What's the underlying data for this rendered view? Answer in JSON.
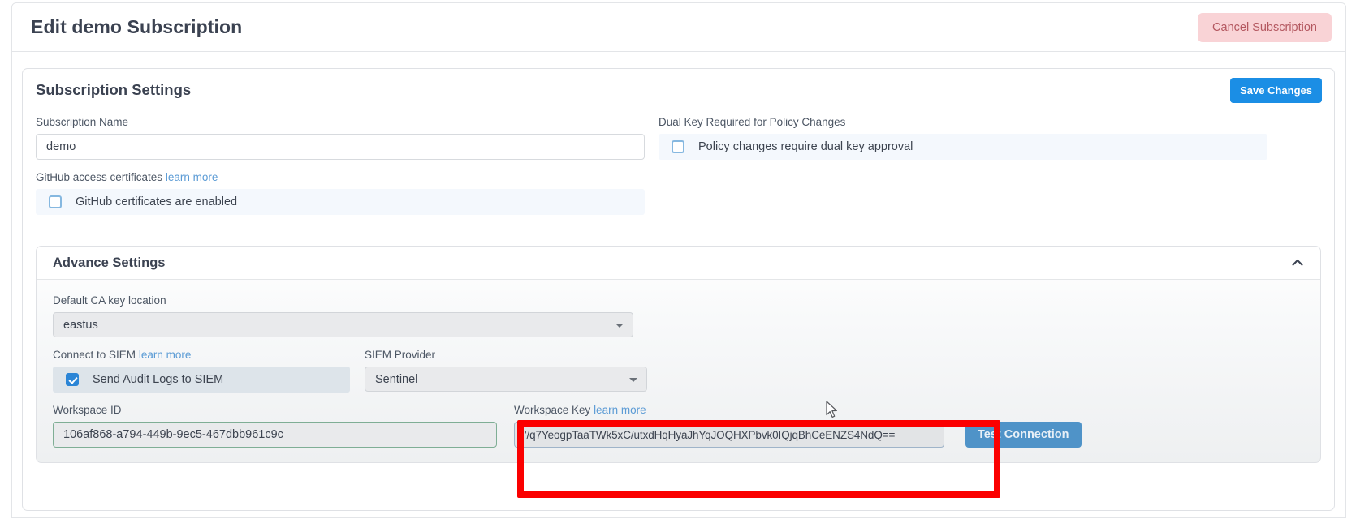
{
  "header": {
    "title": "Edit demo Subscription",
    "cancel_button": "Cancel Subscription"
  },
  "settings_card": {
    "title": "Subscription Settings",
    "save_button": "Save Changes"
  },
  "form": {
    "subscription_name": {
      "label": "Subscription Name",
      "value": "demo"
    },
    "github_certificates": {
      "label": "GitHub access certificates",
      "learn_more": "learn more",
      "checkbox_label": "GitHub certificates are enabled",
      "checked": false
    },
    "dual_key": {
      "label": "Dual Key Required for Policy Changes",
      "checkbox_label": "Policy changes require dual key approval",
      "checked": false
    }
  },
  "advance_settings": {
    "title": "Advance Settings",
    "collapse_icon": "chevron-up-icon",
    "expanded": true,
    "default_ca_key_location": {
      "label": "Default CA key location",
      "value": "eastus"
    },
    "connect_to_siem": {
      "label": "Connect to SIEM",
      "learn_more": "learn more",
      "checkbox_label": "Send Audit Logs to SIEM",
      "checked": true
    },
    "siem_provider": {
      "label": "SIEM Provider",
      "value": "Sentinel"
    },
    "workspace_id": {
      "label": "Workspace ID",
      "value": "106af868-a794-449b-9ec5-467dbb961c9c"
    },
    "workspace_key": {
      "label": "Workspace Key",
      "learn_more": "learn more",
      "value": "'/q7YeogpTaaTWk5xC/utxdHqHyaJhYqJOQHXPbvk0IQjqBhCeENZS4NdQ=="
    },
    "test_connection_button": "Test Connection"
  },
  "colors": {
    "accent_blue": "#1b8ee5",
    "cancel_pink_bg": "#f9d3d6",
    "cancel_pink_text": "#b45860",
    "link_blue": "#5b9bd5",
    "annotation_red": "#fb0000",
    "test_btn_blue": "#4f93c8",
    "checked_blue": "#2b85d6"
  }
}
